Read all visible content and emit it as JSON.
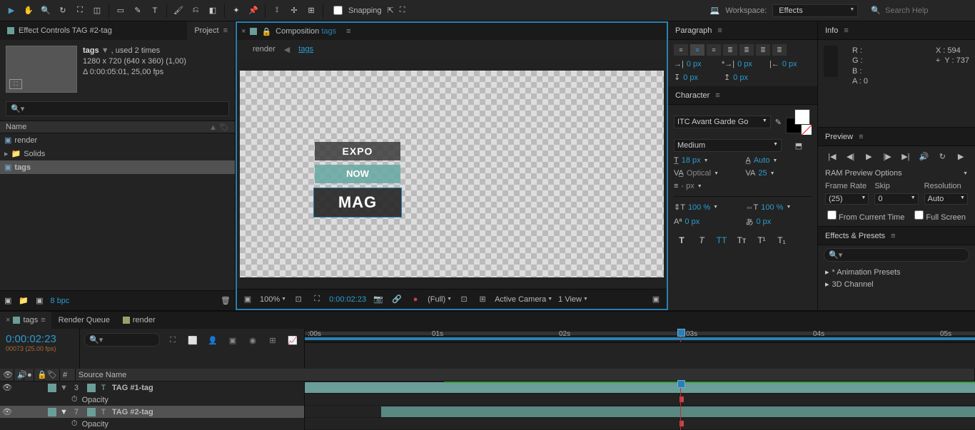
{
  "toolbar": {
    "snapping": "Snapping",
    "workspace_label": "Workspace:",
    "workspace_value": "Effects",
    "search_placeholder": "Search Help"
  },
  "project": {
    "effect_controls_tab": "Effect Controls  TAG #2-tag",
    "project_tab": "Project",
    "name": "tags",
    "used": ", used 2 times",
    "dims": "1280 x 720  (640 x 360) (1,00)",
    "duration": "Δ 0:00:05:01, 25,00 fps",
    "name_header": "Name",
    "items": {
      "render": "render",
      "solids": "Solids",
      "tags": "tags"
    },
    "bpc": "8 bpc"
  },
  "composition": {
    "title_prefix": "Composition ",
    "title_name": "tags",
    "breadcrumb_render": "render",
    "breadcrumb_tags": "tags",
    "canvas": {
      "expo": "EXPO",
      "now": "NOW",
      "mag": "MAG"
    },
    "footer": {
      "zoom": "100%",
      "time": "0:00:02:23",
      "full": "(Full)",
      "camera": "Active Camera",
      "views": "1 View"
    }
  },
  "paragraph": {
    "title": "Paragraph",
    "indent_left": "0 px",
    "indent_first": "0 px",
    "indent_right": "0 px",
    "space_before": "0 px",
    "space_after": "0 px"
  },
  "character": {
    "title": "Character",
    "font": "ITC Avant Garde Go",
    "weight": "Medium",
    "size": "18 px",
    "leading": "Auto",
    "kerning": "Optical",
    "tracking": "25",
    "stroke": "- px",
    "hscale": "100 %",
    "vscale": "100 %",
    "baseline": "0 px",
    "tsume": "0 px"
  },
  "info": {
    "title": "Info",
    "r": "R :",
    "g": "G :",
    "b": "B :",
    "a": "A :  0",
    "x": "X : 594",
    "y": "Y : 737",
    "plus": "+"
  },
  "preview": {
    "title": "Preview",
    "ram_title": "RAM Preview Options",
    "framerate_lbl": "Frame Rate",
    "skip_lbl": "Skip",
    "resolution_lbl": "Resolution",
    "framerate_val": "(25)",
    "skip_val": "0",
    "resolution_val": "Auto",
    "from_current": "From Current Time",
    "full_screen": "Full Screen"
  },
  "effects_presets": {
    "title": "Effects & Presets",
    "items": {
      "anim": "* Animation Presets",
      "chan": "3D Channel"
    }
  },
  "timeline": {
    "tabs": {
      "tags": "tags",
      "render_queue": "Render Queue",
      "render": "render"
    },
    "timecode": "0:00:02:23",
    "frames": "00073 (25.00 fps)",
    "cols": {
      "idx": "#",
      "source": "Source Name"
    },
    "layers": {
      "l1_idx": "3",
      "l1_name": "TAG #1-tag",
      "l1_prop": "Opacity",
      "l2_idx": "7",
      "l2_name": "TAG #2-tag",
      "l2_prop": "Opacity"
    },
    "ruler": {
      "t0": ":00s",
      "t1": "01s",
      "t2": "02s",
      "t3": "03s",
      "t4": "04s",
      "t5": "05s"
    }
  }
}
